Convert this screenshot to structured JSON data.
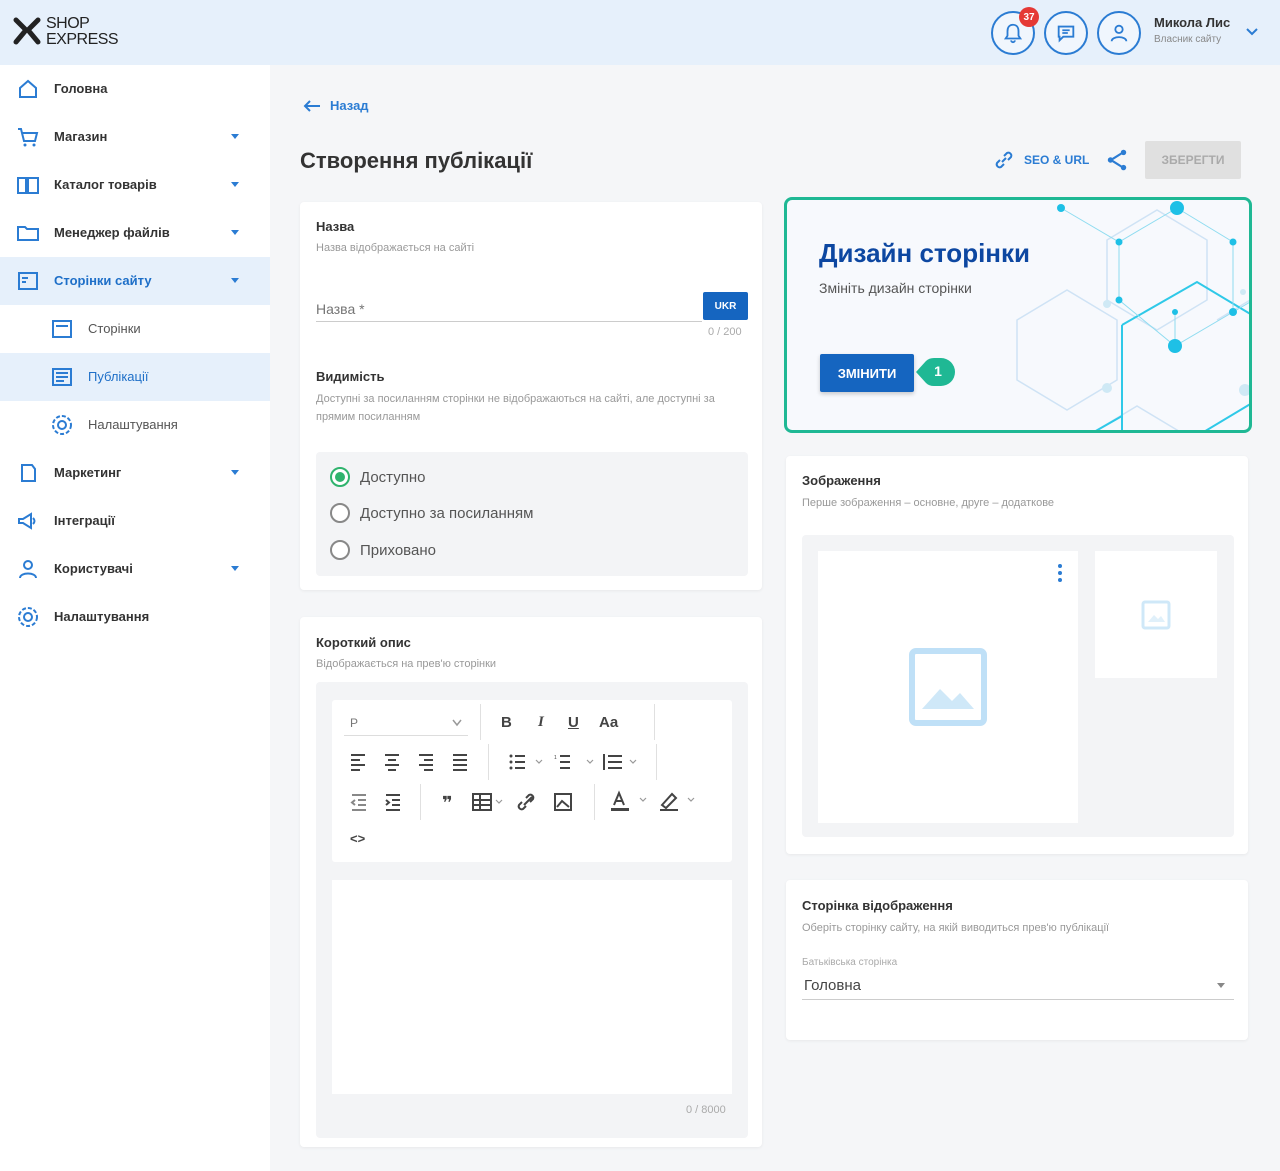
{
  "header": {
    "logo_text_1": "SHOP",
    "logo_text_2": "EXPRESS",
    "notification_count": "37",
    "user_name": "Микола Лис",
    "user_role": "Власник сайту"
  },
  "sidebar": {
    "items": [
      {
        "label": "Головна",
        "icon": "home-icon"
      },
      {
        "label": "Магазин",
        "icon": "cart-icon"
      },
      {
        "label": "Каталог товарів",
        "icon": "book-icon"
      },
      {
        "label": "Менеджер файлів",
        "icon": "folder-icon"
      },
      {
        "label": "Сторінки сайту",
        "icon": "pages-icon"
      },
      {
        "label": "Сторінки",
        "icon": "page-icon"
      },
      {
        "label": "Публікації",
        "icon": "publications-icon"
      },
      {
        "label": "Налаштування",
        "icon": "gear-icon"
      },
      {
        "label": "Маркетинг",
        "icon": "marketing-icon"
      },
      {
        "label": "Інтеграції",
        "icon": "megaphone-icon"
      },
      {
        "label": "Користувачі",
        "icon": "user-icon"
      },
      {
        "label": "Налаштування",
        "icon": "gear-icon"
      }
    ]
  },
  "main": {
    "back_label": "Назад",
    "title": "Створення публікації",
    "seo_label": "SEO & URL",
    "save_label": "ЗБЕРЕГТИ"
  },
  "name_section": {
    "title": "Назва",
    "subtitle": "Назва відображається на сайті",
    "placeholder": "Назва *",
    "lang_button": "UKR",
    "counter": "0 / 200"
  },
  "visibility": {
    "title": "Видимість",
    "subtitle": "Доступні за посиланням сторінки не відображаються на сайті, але доступні за прямим посиланням",
    "options": [
      "Доступно",
      "Доступно за посиланням",
      "Приховано"
    ],
    "selected": "Доступно"
  },
  "short_desc": {
    "title": "Короткий опис",
    "subtitle": "Відображається на прев'ю сторінки",
    "format": "P",
    "counter": "0 / 8000"
  },
  "design": {
    "title": "Дизайн сторінки",
    "subtitle": "Змініть дизайн сторінки",
    "button": "ЗМІНИТИ",
    "step": "1"
  },
  "images": {
    "title": "Зображення",
    "subtitle": "Перше зображення – основне, друге – додаткове"
  },
  "display_page": {
    "title": "Сторінка відображення",
    "subtitle": "Оберіть сторінку сайту, на якій виводиться прев'ю публікації",
    "field_label": "Батьківська сторінка",
    "value": "Головна"
  },
  "colors": {
    "accent": "#1565c0",
    "highlight": "#1fb894",
    "header_bg": "#e6f0fb"
  }
}
